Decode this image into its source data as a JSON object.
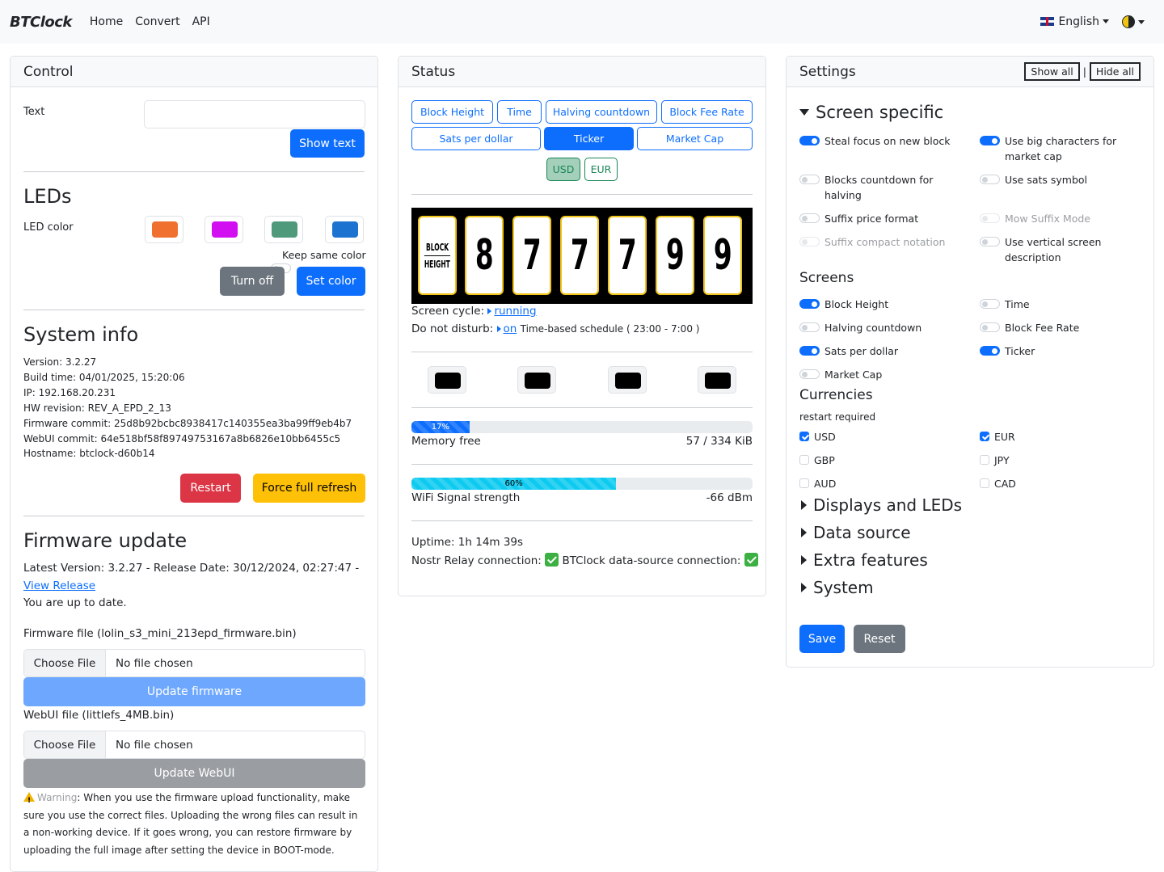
{
  "nav": {
    "brand": "BTClock",
    "links": [
      "Home",
      "Convert",
      "API"
    ],
    "language": "English"
  },
  "control": {
    "title": "Control",
    "text_label": "Text",
    "text_value": "",
    "show_text": "Show text",
    "leds_heading": "LEDs",
    "led_color_label": "LED color",
    "led_colors": [
      "#f07030",
      "#d10ff0",
      "#4f9a7a",
      "#1d74d0"
    ],
    "keep_same_color": "Keep same color",
    "turn_off": "Turn off",
    "set_color": "Set color",
    "system_info_heading": "System info",
    "system_info": [
      "Version: 3.2.27",
      "Build time: 04/01/2025, 15:20:06",
      "IP: 192.168.20.231",
      "HW revision: REV_A_EPD_2_13",
      "Firmware commit: 25d8b92bcbc8938417c140355ea3ba99ff9eb4b7",
      "WebUI commit: 64e518bf58f89749753167a8b6826e10bb6455c5",
      "Hostname: btclock-d60b14"
    ],
    "restart": "Restart",
    "force_full_refresh": "Force full refresh",
    "firmware_heading": "Firmware update",
    "latest_version": "Latest Version: 3.2.27 - Release Date: 30/12/2024, 02:27:47 -",
    "view_release": "View Release",
    "up_to_date": "You are up to date.",
    "firmware_file_label": "Firmware file (lolin_s3_mini_213epd_firmware.bin)",
    "choose_file": "Choose File",
    "no_file_chosen": "No file chosen",
    "update_firmware": "Update firmware",
    "webui_file_label": "WebUI file (littlefs_4MB.bin)",
    "update_webui": "Update WebUI",
    "warning_label": "Warning",
    "warning_text": ": When you use the firmware upload functionality, make sure you use the correct files. Uploading the wrong files can result in a non-working device. If it goes wrong, you can restore firmware by uploading the full image after setting the device in BOOT-mode."
  },
  "status": {
    "title": "Status",
    "screens": [
      "Block Height",
      "Time",
      "Halving countdown",
      "Block Fee Rate",
      "Sats per dollar",
      "Ticker",
      "Market Cap"
    ],
    "active_screen": "Ticker",
    "currencies": [
      "USD",
      "EUR"
    ],
    "active_currency": "USD",
    "display_label_top": "BLOCK",
    "display_label_bottom": "HEIGHT",
    "display_digits": [
      "8",
      "7",
      "7",
      "7",
      "9",
      "9"
    ],
    "screen_cycle_label": "Screen cycle:",
    "screen_cycle_value": "running",
    "dnd_label": "Do not disturb:",
    "dnd_value": "on",
    "dnd_schedule": "Time-based schedule ( 23:00 - 7:00 )",
    "memory_percent": "17%",
    "memory_fraction": 0.17,
    "memory_label": "Memory free",
    "memory_value": "57 / 334 KiB",
    "wifi_percent": "60%",
    "wifi_fraction": 0.6,
    "wifi_label": "WiFi Signal strength",
    "wifi_value": "-66 dBm",
    "uptime": "Uptime: 1h 14m 39s",
    "nostr_label": "Nostr Relay connection:",
    "datasource_label": "BTClock data-source connection:"
  },
  "settings": {
    "title": "Settings",
    "show_all": "Show all",
    "divider": "|",
    "hide_all": "Hide all",
    "screen_specific": "Screen specific",
    "toggles": [
      {
        "label": "Steal focus on new block",
        "on": true
      },
      {
        "label": "Use big characters for market cap",
        "on": true
      },
      {
        "label": "Blocks countdown for halving",
        "on": false
      },
      {
        "label": "Use sats symbol",
        "on": false
      },
      {
        "label": "Suffix price format",
        "on": false
      },
      {
        "label": "Mow Suffix Mode",
        "on": false,
        "disabled": true
      },
      {
        "label": "Suffix compact notation",
        "on": false,
        "disabled": true
      },
      {
        "label": "Use vertical screen description",
        "on": false
      }
    ],
    "screens_heading": "Screens",
    "screens": [
      {
        "label": "Block Height",
        "on": true
      },
      {
        "label": "Time",
        "on": false
      },
      {
        "label": "Halving countdown",
        "on": false
      },
      {
        "label": "Block Fee Rate",
        "on": false
      },
      {
        "label": "Sats per dollar",
        "on": true
      },
      {
        "label": "Ticker",
        "on": true
      },
      {
        "label": "Market Cap",
        "on": false
      }
    ],
    "currencies_heading": "Currencies",
    "restart_required": "restart required",
    "currencies": [
      {
        "label": "USD",
        "on": true
      },
      {
        "label": "EUR",
        "on": true
      },
      {
        "label": "GBP",
        "on": false
      },
      {
        "label": "JPY",
        "on": false
      },
      {
        "label": "AUD",
        "on": false
      },
      {
        "label": "CAD",
        "on": false
      }
    ],
    "sections": [
      "Displays and LEDs",
      "Data source",
      "Extra features",
      "System"
    ],
    "save": "Save",
    "reset": "Reset"
  }
}
